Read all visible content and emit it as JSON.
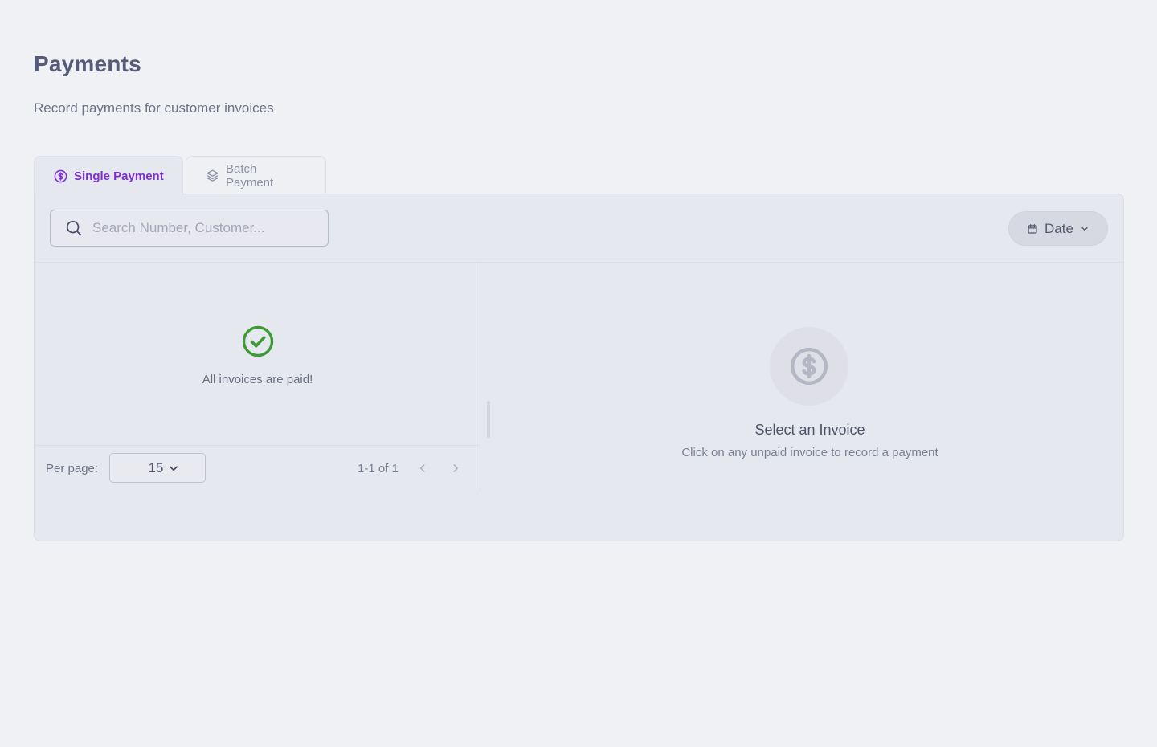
{
  "header": {
    "title": "Payments",
    "subtitle": "Record payments for customer invoices"
  },
  "tabs": [
    {
      "label": "Single Payment",
      "icon": "dollar-circle-icon",
      "active": true
    },
    {
      "label": "Batch Payment",
      "icon": "layers-icon",
      "active": false
    }
  ],
  "toolbar": {
    "search_placeholder": "Search Number, Customer...",
    "search_value": "",
    "date_label": "Date"
  },
  "invoice_list": {
    "empty_message": "All invoices are paid!",
    "per_page_label": "Per page:",
    "per_page_value": "15",
    "range_text": "1-1 of 1"
  },
  "detail": {
    "title": "Select an Invoice",
    "hint": "Click on any unpaid invoice to record a payment"
  },
  "colors": {
    "accent": "#7b2fd0",
    "success": "#3d9a34",
    "background": "#f0f1f5",
    "panel": "#e6e8ef"
  }
}
